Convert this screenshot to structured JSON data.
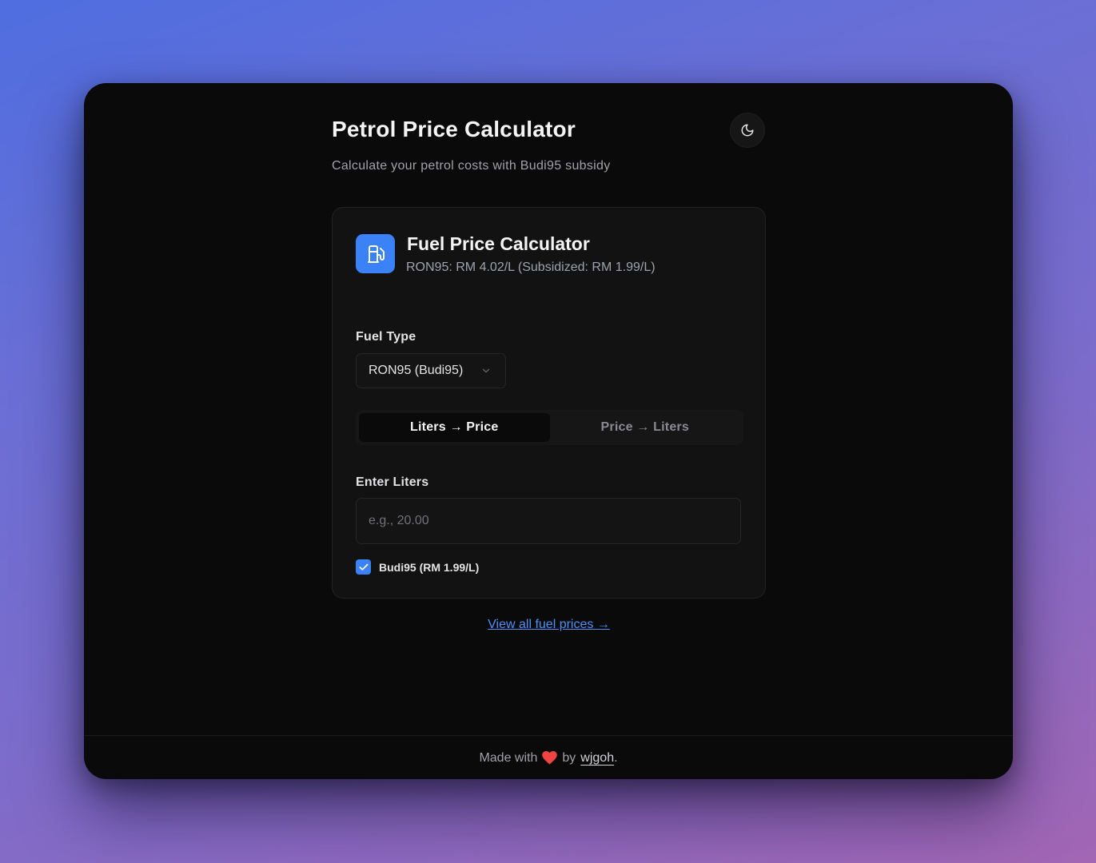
{
  "header": {
    "title": "Petrol Price Calculator",
    "subtitle": "Calculate your petrol costs with Budi95 subsidy"
  },
  "theme_toggle": {
    "icon": "moon-icon"
  },
  "card": {
    "icon": "fuel-pump-icon",
    "title": "Fuel Price Calculator",
    "subtitle": "RON95: RM 4.02/L (Subsidized: RM 1.99/L)"
  },
  "fuel_type": {
    "label": "Fuel Type",
    "selected": "RON95 (Budi95)"
  },
  "tabs": [
    {
      "label": "Liters → Price",
      "active": true
    },
    {
      "label": "Price → Liters",
      "active": false
    }
  ],
  "liters_input": {
    "label": "Enter Liters",
    "placeholder": "e.g., 20.00",
    "value": ""
  },
  "subsidy_checkbox": {
    "label": "Budi95 (RM 1.99/L)",
    "checked": true
  },
  "view_prices_link": "View all fuel prices →",
  "footer": {
    "made_with": "Made with",
    "by": "by",
    "author": "wjgoh",
    "period": "."
  },
  "colors": {
    "accent": "#3b82f6",
    "link": "#4f8ff7",
    "heart": "#ef4444",
    "window_bg": "#0a0a0a",
    "card_bg": "#121212"
  }
}
